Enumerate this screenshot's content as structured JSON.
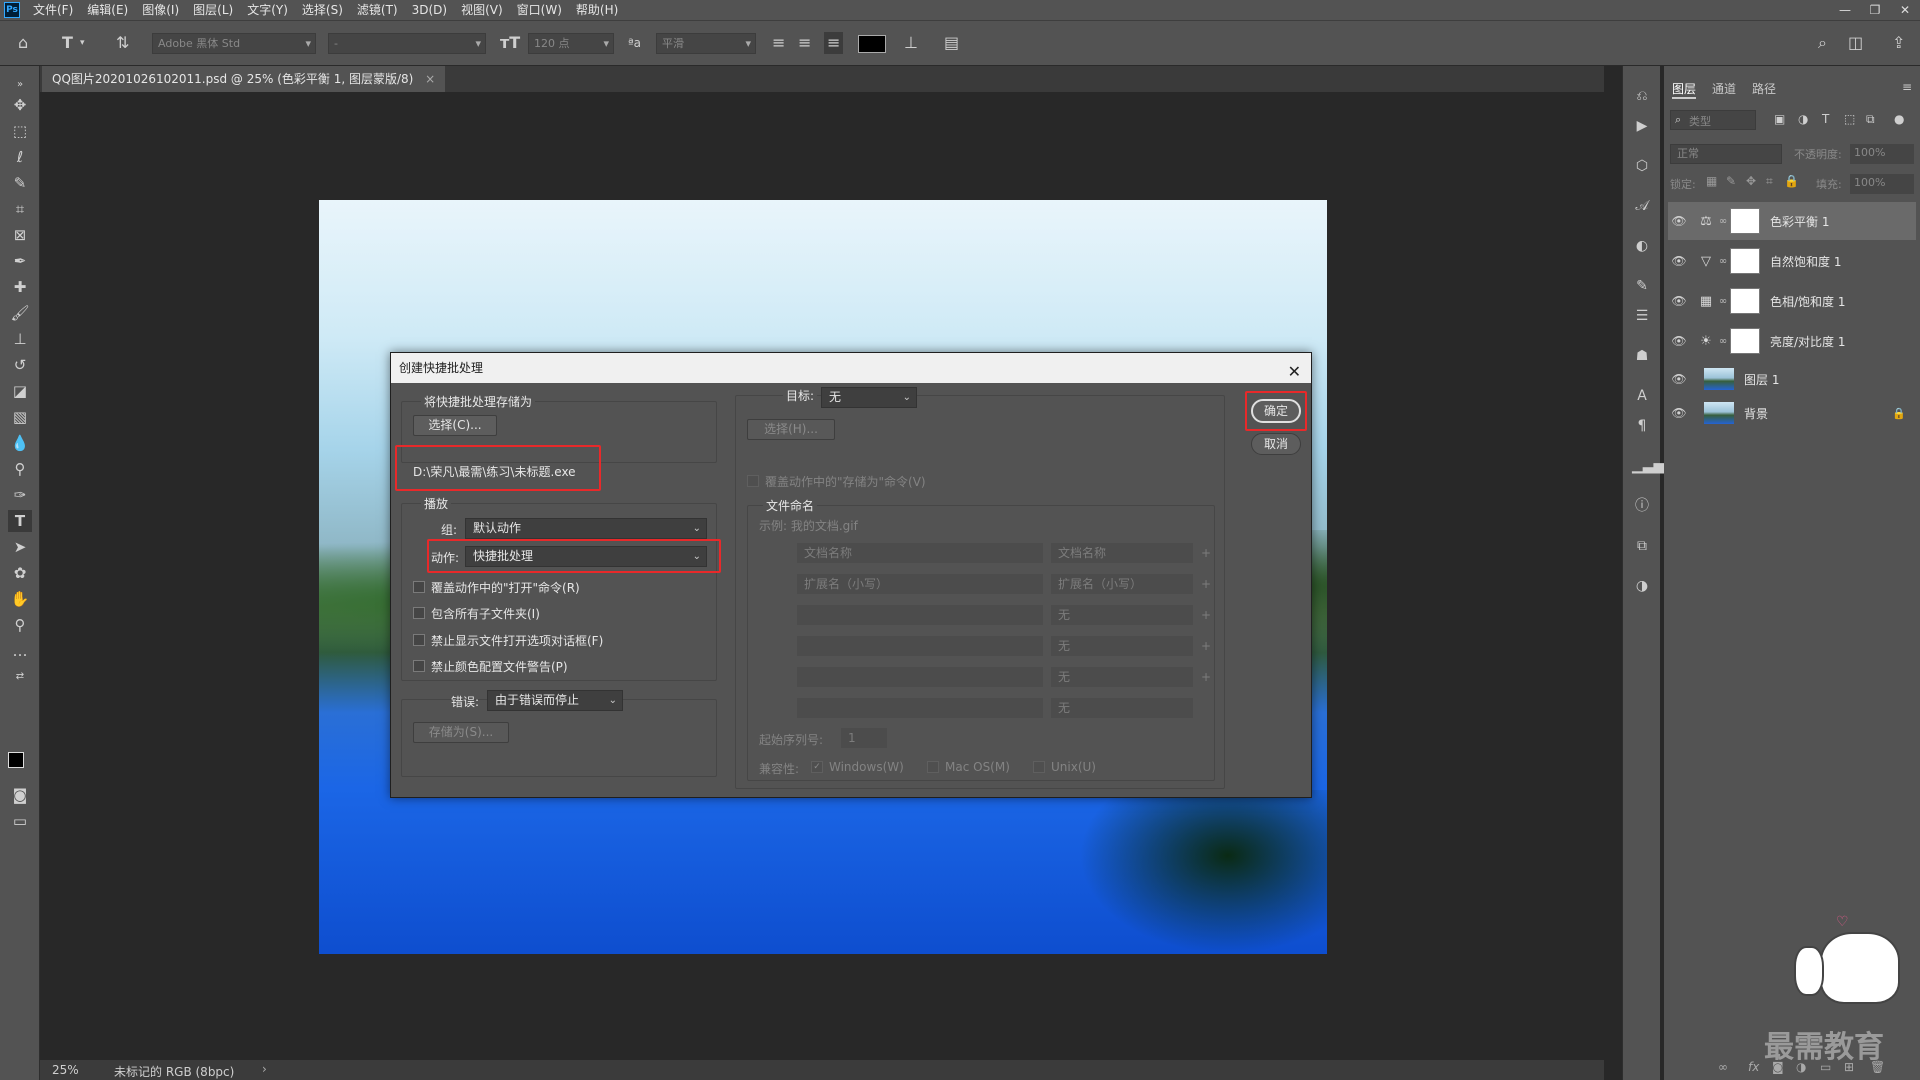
{
  "menubar": {
    "logo": "Ps",
    "items": [
      "文件(F)",
      "编辑(E)",
      "图像(I)",
      "图层(L)",
      "文字(Y)",
      "选择(S)",
      "滤镜(T)",
      "3D(D)",
      "视图(V)",
      "窗口(W)",
      "帮助(H)"
    ],
    "window_controls": [
      "—",
      "❐",
      "✕"
    ]
  },
  "options": {
    "font_family": "Adobe 黑体 Std",
    "font_style": "-",
    "font_size": "120 点",
    "antialias": "平滑",
    "text_color": "#000000"
  },
  "document": {
    "tab_title": "QQ图片20201026102011.psd @ 25% (色彩平衡 1, 图层蒙版/8)",
    "tab_close": "×",
    "zoom": "25%",
    "color_profile": "未标记的 RGB (8bpc)",
    "status_arrow": "›"
  },
  "layers_panel": {
    "tabs": [
      "图层",
      "通道",
      "路径"
    ],
    "filter_placeholder": "类型",
    "blend_mode": "正常",
    "opacity_label": "不透明度:",
    "opacity_value": "100%",
    "lock_label": "锁定:",
    "fill_label": "填充:",
    "fill_value": "100%",
    "layers": [
      {
        "name": "色彩平衡 1",
        "icon": "balance-icon",
        "glyph": "⚖"
      },
      {
        "name": "自然饱和度 1",
        "icon": "vibrance-icon",
        "glyph": "▽"
      },
      {
        "name": "色相/饱和度 1",
        "icon": "hue-icon",
        "glyph": "▦"
      },
      {
        "name": "亮度/对比度 1",
        "icon": "brightness-icon",
        "glyph": "☀"
      },
      {
        "name": "图层 1"
      },
      {
        "name": "背景",
        "locked": true
      }
    ]
  },
  "watermark": "最需教育",
  "dialog": {
    "title": "创建快捷批处理",
    "save_group": "将快捷批处理存储为",
    "choose_button": "选择(C)...",
    "save_path": "D:\\荣凡\\最需\\练习\\未标题.exe",
    "play_group": "播放",
    "set_label": "组:",
    "set_value": "默认动作",
    "action_label": "动作:",
    "action_value": "快捷批处理",
    "options": [
      "覆盖动作中的\"打开\"命令(R)",
      "包含所有子文件夹(I)",
      "禁止显示文件打开选项对话框(F)",
      "禁止颜色配置文件警告(P)"
    ],
    "errors_label": "错误:",
    "errors_value": "由于错误而停止",
    "save_as_button": "存储为(S)...",
    "dest_label": "目标:",
    "dest_value": "无",
    "dest_choose": "选择(H)...",
    "override_save": "覆盖动作中的\"存储为\"命令(V)",
    "file_naming": "文件命名",
    "example": "示例: 我的文档.gif",
    "naming_rows": [
      [
        "文档名称",
        "文档名称"
      ],
      [
        "扩展名（小写）",
        "扩展名（小写）"
      ],
      [
        "",
        "无"
      ],
      [
        "",
        "无"
      ],
      [
        "",
        "无"
      ],
      [
        "",
        "无"
      ]
    ],
    "serial_label": "起始序列号:",
    "serial_value": "1",
    "compat_label": "兼容性:",
    "compat": [
      "Windows(W)",
      "Mac OS(M)",
      "Unix(U)"
    ],
    "ok_button": "确定",
    "cancel_button": "取消"
  }
}
